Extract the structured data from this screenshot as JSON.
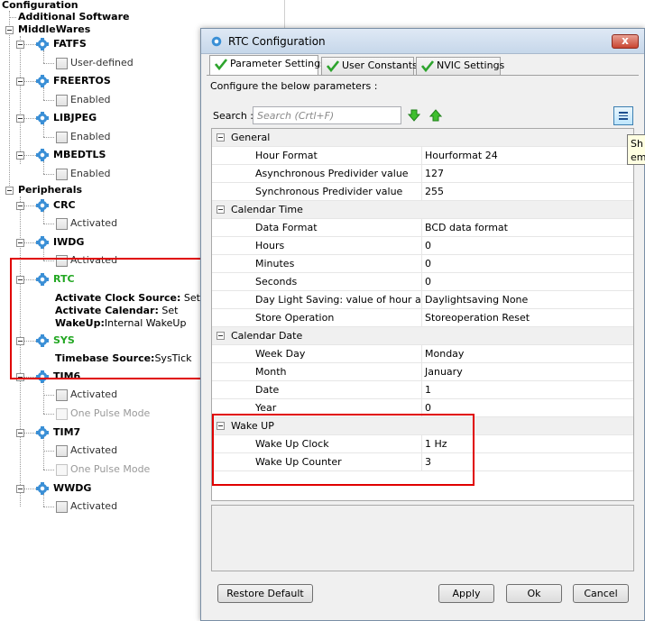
{
  "tree": {
    "root": "Configuration",
    "additional_software": "Additional Software",
    "middlewares": {
      "label": "MiddleWares",
      "items": [
        {
          "name": "FATFS",
          "option": "User-defined"
        },
        {
          "name": "FREERTOS",
          "option": "Enabled"
        },
        {
          "name": "LIBJPEG",
          "option": "Enabled"
        },
        {
          "name": "MBEDTLS",
          "option": "Enabled"
        }
      ]
    },
    "peripherals": {
      "label": "Peripherals",
      "crc": {
        "name": "CRC",
        "option": "Activated"
      },
      "iwdg": {
        "name": "IWDG",
        "option": "Activated"
      },
      "rtc": {
        "name": "RTC",
        "details": [
          {
            "key": "Activate Clock Source:",
            "value": " Set"
          },
          {
            "key": "Activate Calendar:",
            "value": " Set"
          },
          {
            "key": "WakeUp:",
            "value": "Internal WakeUp"
          }
        ]
      },
      "sys": {
        "name": "SYS",
        "key": "Timebase Source:",
        "value": "SysTick"
      },
      "tim6": {
        "name": "TIM6",
        "options": [
          "Activated",
          "One Pulse Mode"
        ]
      },
      "tim7": {
        "name": "TIM7",
        "options": [
          "Activated",
          "One Pulse Mode"
        ]
      },
      "wwdg": {
        "name": "WWDG",
        "option": "Activated"
      }
    }
  },
  "dialog": {
    "title": "RTC Configuration",
    "close_label": "x",
    "tabs": [
      "Parameter Settings",
      "User Constants",
      "NVIC Settings"
    ],
    "configure_text": "Configure the below parameters :",
    "search_label": "Search :",
    "search_placeholder": "Search (Crtl+F)",
    "tooltip": "Sh em",
    "groups": [
      {
        "name": "General",
        "rows": [
          {
            "name": "Hour Format",
            "value": "Hourformat 24"
          },
          {
            "name": "Asynchronous Predivider value",
            "value": "127"
          },
          {
            "name": "Synchronous Predivider value",
            "value": "255"
          }
        ]
      },
      {
        "name": "Calendar Time",
        "rows": [
          {
            "name": "Data Format",
            "value": "BCD data format"
          },
          {
            "name": "Hours",
            "value": "0"
          },
          {
            "name": "Minutes",
            "value": "0"
          },
          {
            "name": "Seconds",
            "value": "0"
          },
          {
            "name": "Day Light Saving: value of hour adj...",
            "value": "Daylightsaving None"
          },
          {
            "name": "Store Operation",
            "value": "Storeoperation Reset"
          }
        ]
      },
      {
        "name": "Calendar Date",
        "rows": [
          {
            "name": "Week Day",
            "value": "Monday"
          },
          {
            "name": "Month",
            "value": "January"
          },
          {
            "name": "Date",
            "value": "1"
          },
          {
            "name": "Year",
            "value": "0"
          }
        ]
      },
      {
        "name": "Wake UP",
        "rows": [
          {
            "name": "Wake Up Clock",
            "value": "1 Hz"
          },
          {
            "name": "Wake Up Counter",
            "value": "3"
          }
        ]
      }
    ],
    "buttons": {
      "restore": "Restore Default",
      "apply": "Apply",
      "ok": "Ok",
      "cancel": "Cancel"
    }
  },
  "colors": {
    "highlight": "#e00000",
    "active_item": "#22a722",
    "gear": "#3a8fd6"
  }
}
